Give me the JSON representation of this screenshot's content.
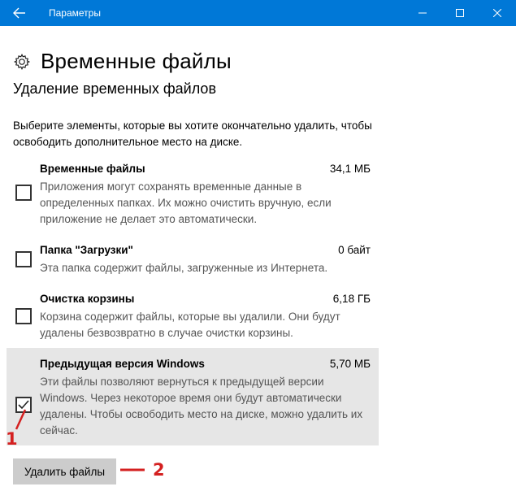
{
  "window": {
    "title": "Параметры",
    "accent": "#0078d7"
  },
  "header": {
    "title": "Временные файлы",
    "icon": "gear-icon"
  },
  "section": {
    "title": "Удаление временных файлов",
    "description": "Выберите элементы, которые вы хотите окончательно удалить, чтобы освободить дополнительное место на диске."
  },
  "items": [
    {
      "name": "Временные файлы",
      "size": "34,1 МБ",
      "description": "Приложения могут сохранять временные данные в определенных папках. Их можно очистить вручную, если приложение не делает это автоматически.",
      "checked": false
    },
    {
      "name": "Папка \"Загрузки\"",
      "size": "0 байт",
      "description": "Эта папка содержит файлы, загруженные из Интернета.",
      "checked": false
    },
    {
      "name": "Очистка корзины",
      "size": "6,18 ГБ",
      "description": "Корзина содержит файлы, которые вы удалили. Они будут удалены безвозвратно в случае очистки корзины.",
      "checked": false
    },
    {
      "name": "Предыдущая версия Windows",
      "size": "5,70 МБ",
      "description": "Эти файлы позволяют вернуться к предыдущей версии Windows. Через некоторое время они будут автоматически удалены. Чтобы освободить место на диске, можно удалить их сейчас.",
      "checked": true
    }
  ],
  "actions": {
    "delete_label": "Удалить файлы"
  },
  "annotations": {
    "marker1": "1",
    "marker2": "2",
    "color": "#d42020"
  }
}
